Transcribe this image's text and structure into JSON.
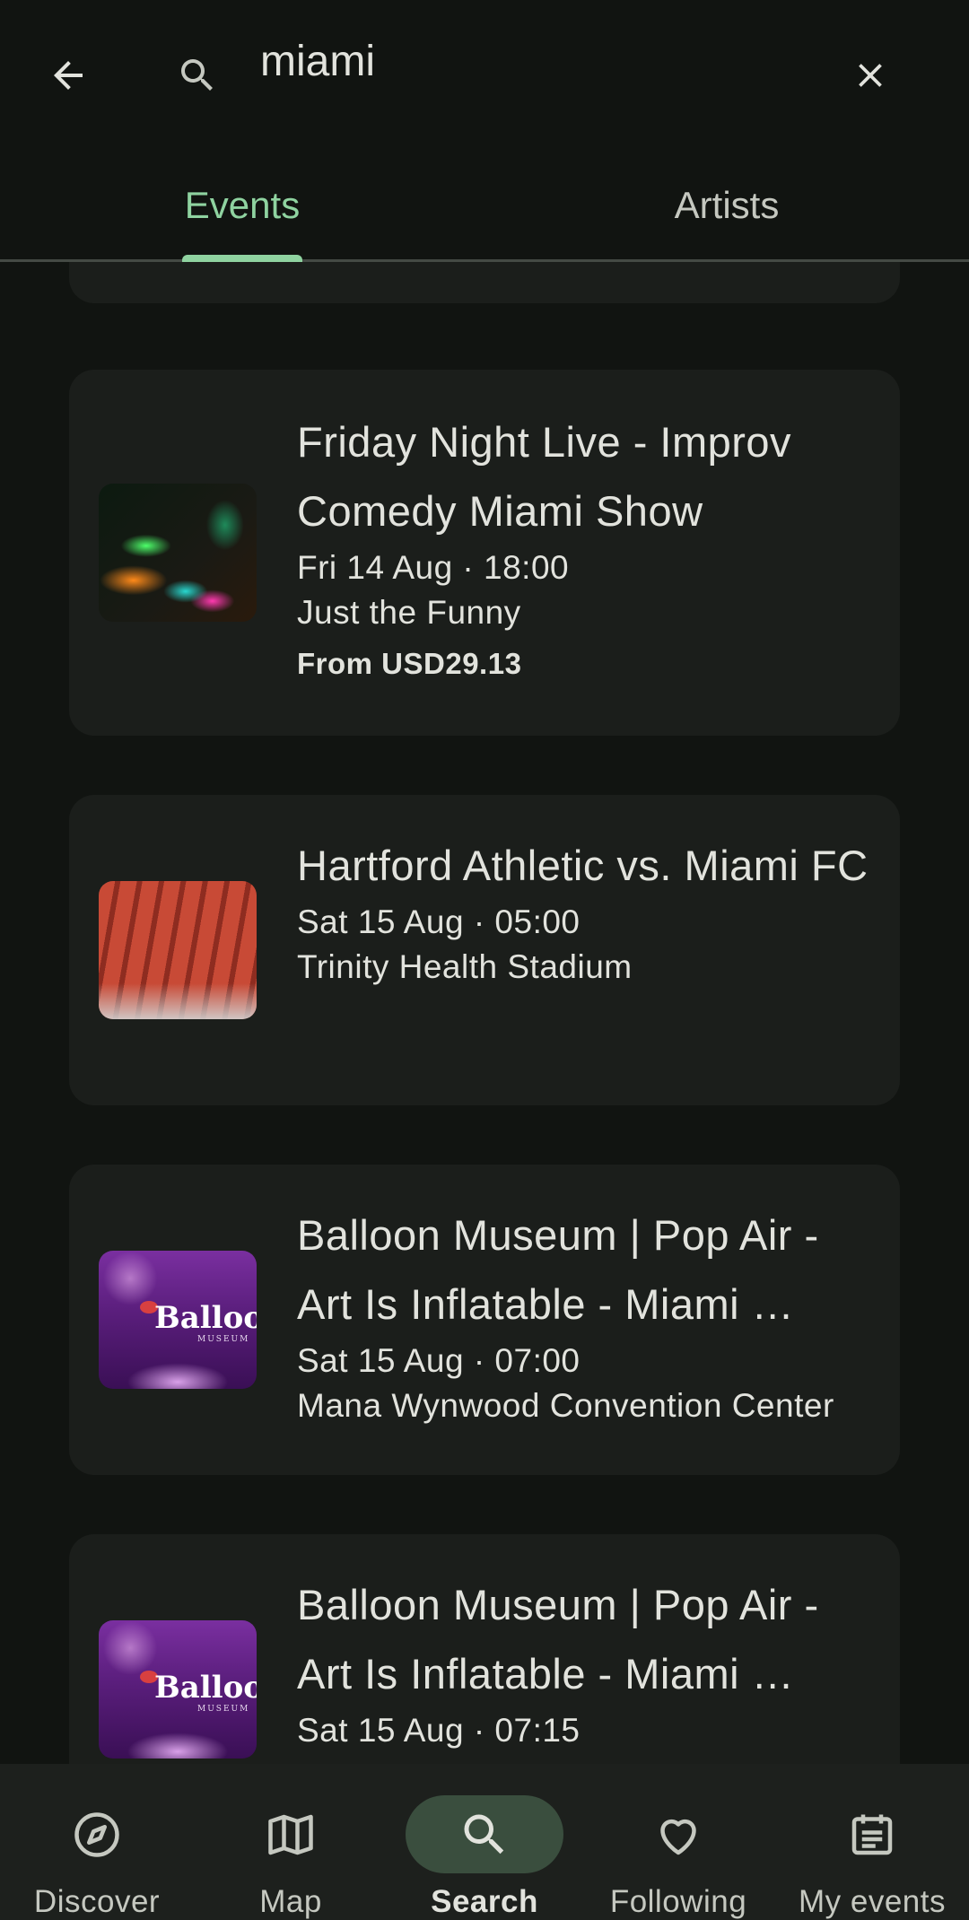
{
  "search": {
    "query": "miami",
    "placeholder": ""
  },
  "tabs": [
    {
      "label": "Events",
      "selected": true
    },
    {
      "label": "Artists",
      "selected": false
    }
  ],
  "events": [
    {
      "title": "Friday Night Live - Improv Comedy Miami Show",
      "date": "Fri 14 Aug · 18:00",
      "venue": "Just the Funny",
      "price": "From USD29.13"
    },
    {
      "title": "Hartford Athletic vs. Miami FC",
      "date": "Sat 15 Aug · 05:00",
      "venue": "Trinity Health Stadium"
    },
    {
      "title": "Balloon Museum | Pop Air - Art Is Inflatable - Miami …",
      "date": "Sat 15 Aug · 07:00",
      "venue": "Mana Wynwood Convention Center"
    },
    {
      "title": "Balloon Museum | Pop Air - Art Is Inflatable - Miami …",
      "date": "Sat 15 Aug · 07:15",
      "venue": ""
    }
  ],
  "thumb_text": {
    "balloon": "Balloo",
    "balloon_sub": "MUSEUM"
  },
  "bottom_nav": [
    {
      "label": "Discover",
      "icon": "compass-icon",
      "active": false
    },
    {
      "label": "Map",
      "icon": "map-icon",
      "active": false
    },
    {
      "label": "Search",
      "icon": "search-icon",
      "active": true
    },
    {
      "label": "Following",
      "icon": "heart-icon",
      "active": false
    },
    {
      "label": "My events",
      "icon": "calendar-list-icon",
      "active": false
    }
  ],
  "colors": {
    "background": "#111411",
    "card": "#1b1e1b",
    "accent": "#8fd3a0",
    "nav_background": "#1d201d",
    "nav_active_pill": "#3a4e3e"
  }
}
